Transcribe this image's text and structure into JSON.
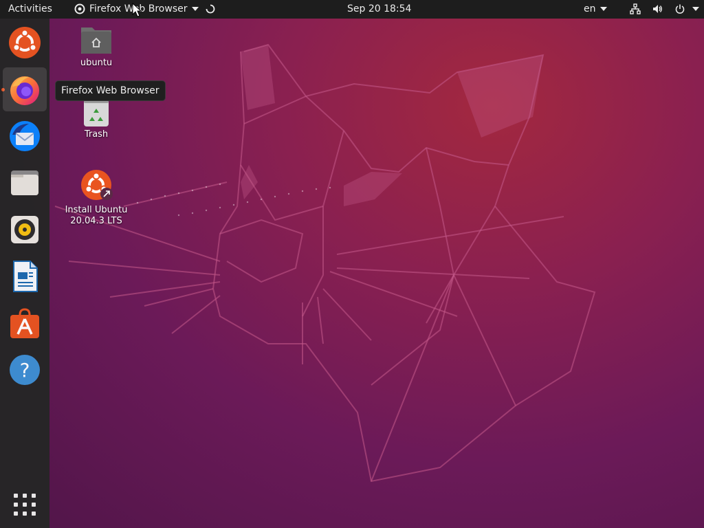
{
  "topbar": {
    "activities_label": "Activities",
    "app_menu_label": "Firefox Web Browser",
    "clock": "Sep 20  18:54",
    "keyboard_layout": "en"
  },
  "dock": {
    "items": [
      {
        "name": "Ubuntu"
      },
      {
        "name": "Firefox Web Browser",
        "running": true,
        "hovered": true
      },
      {
        "name": "Thunderbird Mail"
      },
      {
        "name": "Files"
      },
      {
        "name": "Rhythmbox"
      },
      {
        "name": "LibreOffice Writer"
      },
      {
        "name": "Ubuntu Software"
      },
      {
        "name": "Help"
      }
    ],
    "show_apps": "show-applications"
  },
  "tooltip": "Firefox Web Browser",
  "desktop": {
    "home_label": "ubuntu",
    "trash_label": "Trash",
    "installer_label_line1": "Install Ubuntu",
    "installer_label_line2": "20.04.3 LTS"
  },
  "colors": {
    "accent": "#e95420",
    "topbar": "#1d1d1d",
    "dock": "#262626"
  }
}
